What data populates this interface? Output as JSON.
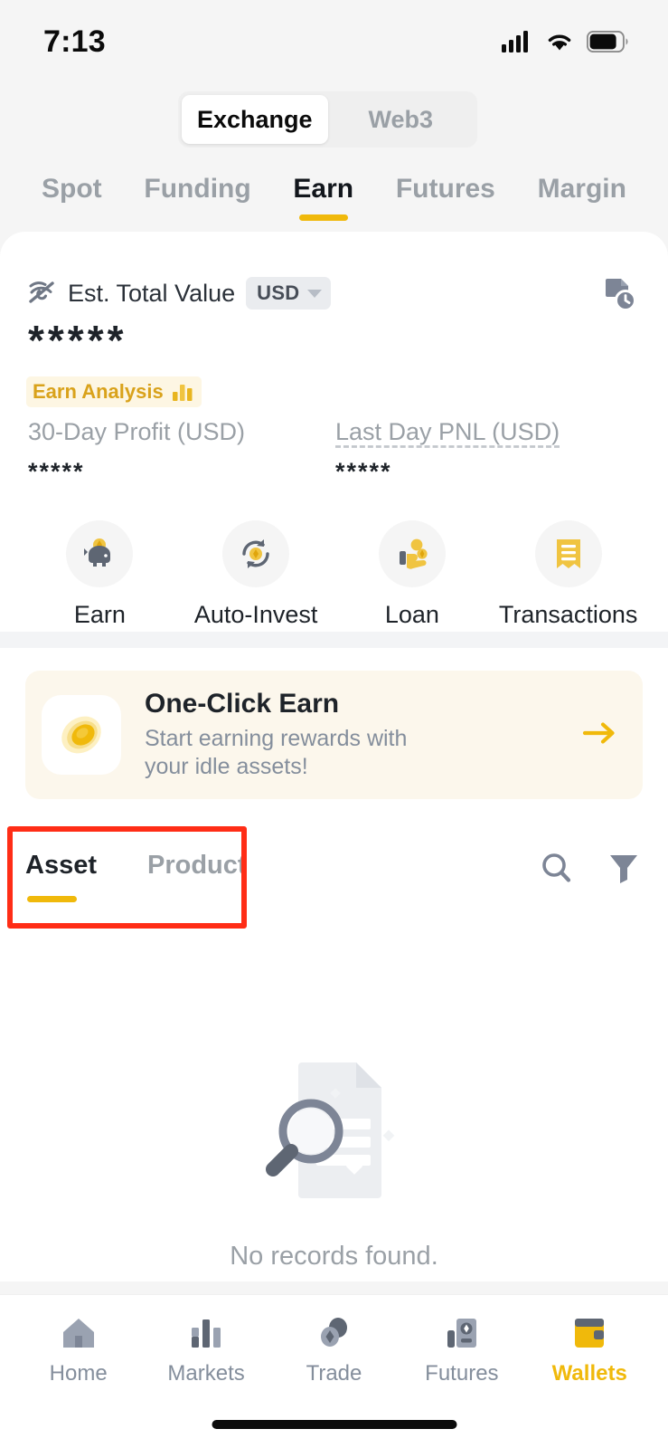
{
  "status_bar": {
    "time": "7:13",
    "icons": [
      "cellular-signal-icon",
      "wifi-icon",
      "battery-icon"
    ]
  },
  "segmented_control": {
    "options": [
      {
        "label": "Exchange",
        "active": true
      },
      {
        "label": "Web3",
        "active": false
      }
    ]
  },
  "top_tabs": [
    {
      "label": "Spot",
      "active": false
    },
    {
      "label": "Funding",
      "active": false
    },
    {
      "label": "Earn",
      "active": true
    },
    {
      "label": "Futures",
      "active": false
    },
    {
      "label": "Margin",
      "active": false
    }
  ],
  "account": {
    "eye_icon": "eye-off-icon",
    "est_total_value_label": "Est. Total Value",
    "currency": "USD",
    "currency_caret": "chevron-down-icon",
    "history_icon": "transaction-history-icon",
    "balance_masked": "*****",
    "earn_analysis_label": "Earn Analysis",
    "earn_analysis_icon": "bar-chart-icon",
    "profit_30day_label": "30-Day Profit (USD)",
    "profit_30day_value": "*****",
    "last_day_pnl_label": "Last Day PNL (USD)",
    "last_day_pnl_value": "*****"
  },
  "quick_actions": [
    {
      "label": "Earn",
      "icon": "piggy-bank-icon"
    },
    {
      "label": "Auto-Invest",
      "icon": "auto-invest-recycle-icon"
    },
    {
      "label": "Loan",
      "icon": "hand-coins-icon"
    },
    {
      "label": "Transactions",
      "icon": "receipt-icon"
    }
  ],
  "banner": {
    "icon": "gold-coin-icon",
    "title": "One-Click Earn",
    "subtitle": "Start earning rewards with your idle assets!",
    "arrow_icon": "arrow-right-icon"
  },
  "sub_tabs": [
    {
      "label": "Asset",
      "active": true
    },
    {
      "label": "Product",
      "active": false
    }
  ],
  "sub_tools": [
    {
      "icon": "search-icon",
      "name": "search-button"
    },
    {
      "icon": "filter-icon",
      "name": "filter-button"
    }
  ],
  "empty_state": {
    "illustration": "document-magnifier-icon",
    "message": "No records found."
  },
  "bottom_nav": [
    {
      "label": "Home",
      "icon": "home-icon",
      "active": false
    },
    {
      "label": "Markets",
      "icon": "markets-bars-icon",
      "active": false
    },
    {
      "label": "Trade",
      "icon": "trade-coins-icon",
      "active": false
    },
    {
      "label": "Futures",
      "icon": "futures-icon",
      "active": false
    },
    {
      "label": "Wallets",
      "icon": "wallet-icon",
      "active": true
    }
  ],
  "colors": {
    "brand_yellow": "#f0b90b",
    "annotation_red": "#ff2d16",
    "text_primary": "#1e2329",
    "text_secondary": "#848e9c",
    "banner_bg": "#fcf7ec"
  }
}
